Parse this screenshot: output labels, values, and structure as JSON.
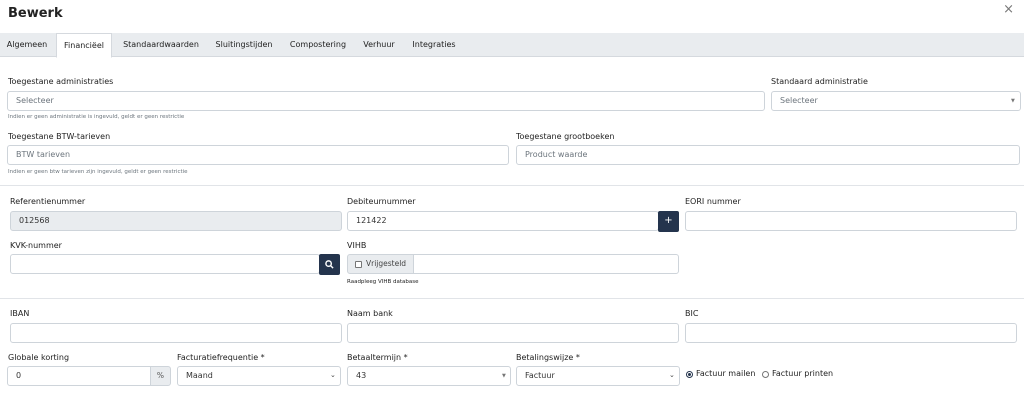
{
  "modal": {
    "title": "Bewerk",
    "close_icon": "×"
  },
  "tabs": [
    {
      "label": "Algemeen",
      "active": false
    },
    {
      "label": "Financiëel",
      "active": true
    },
    {
      "label": "Standaardwaarden",
      "active": false
    },
    {
      "label": "Sluitingstijden",
      "active": false
    },
    {
      "label": "Compostering",
      "active": false
    },
    {
      "label": "Verhuur",
      "active": false
    },
    {
      "label": "Integraties",
      "active": false
    }
  ],
  "administraties": {
    "label": "Toegestane administraties",
    "placeholder": "Selecteer",
    "help": "Indien er geen administratie is ingevuld, geldt er geen restrictie"
  },
  "standaard_administratie": {
    "label": "Standaard administratie",
    "placeholder": "Selecteer"
  },
  "btw": {
    "label": "Toegestane BTW-tarieven",
    "placeholder": "BTW tarieven",
    "help": "Indien er geen btw tarieven zijn ingevuld, geldt er geen restrictie"
  },
  "grootboeken": {
    "label": "Toegestane grootboeken",
    "placeholder": "Product waarde"
  },
  "referentienummer": {
    "label": "Referentienummer",
    "value": "012568"
  },
  "debiteurnummer": {
    "label": "Debiteurnummer",
    "value": "121422",
    "add_icon": "+"
  },
  "eori": {
    "label": "EORI nummer",
    "value": ""
  },
  "kvk": {
    "label": "KVK-nummer",
    "value": "",
    "search_icon": "search"
  },
  "vihb": {
    "label": "VIHB",
    "checkbox_label": "Vrijgesteld",
    "checked": false,
    "value": "",
    "help": "Raadpleeg VIHB database"
  },
  "iban": {
    "label": "IBAN",
    "value": ""
  },
  "naam_bank": {
    "label": "Naam bank",
    "value": ""
  },
  "bic": {
    "label": "BIC",
    "value": ""
  },
  "korting": {
    "label": "Globale korting",
    "value": "0",
    "unit": "%"
  },
  "facturatiefrequentie": {
    "label": "Facturatiefrequentie *",
    "value": "Maand"
  },
  "betaaltermijn": {
    "label": "Betaaltermijn *",
    "value": "43"
  },
  "betalingswijze": {
    "label": "Betalingswijze *",
    "value": "Factuur"
  },
  "factuur_opties": [
    {
      "label": "Factuur mailen",
      "checked": true
    },
    {
      "label": "Factuur printen",
      "checked": false
    }
  ],
  "colors": {
    "accent": "#24344d",
    "tabbar": "#e9ecef",
    "border": "#ced4da"
  }
}
